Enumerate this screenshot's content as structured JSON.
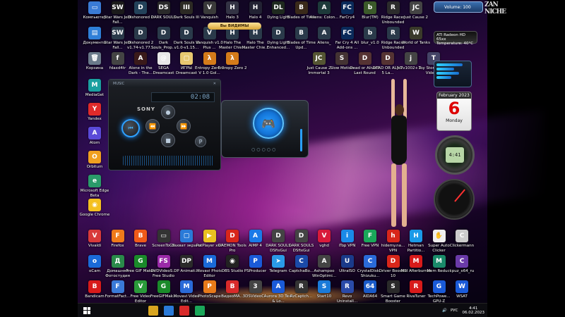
{
  "desktop": {
    "row1": [
      {
        "label": "Компьютер",
        "color": "#3a7bd5",
        "glyph": "▭"
      },
      {
        "label": "Star Wars Jedi Fall...",
        "color": "#1b1b1b",
        "glyph": "SW"
      },
      {
        "label": "Dishonored 2",
        "color": "#23425a",
        "glyph": "D"
      },
      {
        "label": "DARK SOULS",
        "color": "#2a2a2a",
        "glyph": "DS"
      },
      {
        "label": "Dark Souls III",
        "color": "#2c2a24",
        "glyph": "III"
      },
      {
        "label": "Vanquish",
        "color": "#3a3a3a",
        "glyph": "V"
      },
      {
        "label": "Halo 3",
        "color": "#334",
        "glyph": "H"
      },
      {
        "label": "Halo 4",
        "color": "#223",
        "glyph": "H"
      },
      {
        "label": "Dying Light",
        "color": "#1f2a1f",
        "glyph": "DL"
      },
      {
        "label": "Blades of Time",
        "color": "#3a2a1a",
        "glyph": "B"
      },
      {
        "label": "Aliens: Colon...",
        "color": "#1d3a3a",
        "glyph": "A"
      },
      {
        "label": "FarCry4",
        "color": "#0a2a5a",
        "glyph": "FC"
      },
      {
        "label": "Blur(TM)",
        "color": "#3b5a2a",
        "glyph": "b"
      },
      {
        "label": "Ridge Racer Unbounded",
        "color": "#2c2c2c",
        "glyph": "R"
      },
      {
        "label": "Just Cause 2",
        "color": "#444",
        "glyph": "JC"
      }
    ],
    "row2": [
      {
        "label": "Документы",
        "color": "#2f7fd8",
        "glyph": "▤"
      },
      {
        "label": "Star Wars Jedi Fall...",
        "color": "#2a3a4a",
        "glyph": "SW"
      },
      {
        "label": "Dishonored 2 v1.74-v1.77...",
        "color": "#2a3a4a",
        "glyph": "D"
      },
      {
        "label": "Dark Souls_Prop...",
        "color": "#2a3a4a",
        "glyph": "D"
      },
      {
        "label": "Dark Souls III v1.0-v1.15...",
        "color": "#2a3a4a",
        "glyph": "D"
      },
      {
        "label": "Vanquish v1.0 Plus ...",
        "color": "#2a3a4a",
        "glyph": "V"
      },
      {
        "label": "Halo The Master Chie...",
        "color": "#2a3a4a",
        "glyph": "H"
      },
      {
        "label": "Halo The Master Chie...",
        "color": "#2a3a4a",
        "glyph": "H"
      },
      {
        "label": "Dying Light Enhanced...",
        "color": "#2a3a4a",
        "glyph": "D"
      },
      {
        "label": "Blades of Time Upd...",
        "color": "#2a3a4a",
        "glyph": "B"
      },
      {
        "label": "Aliens_",
        "color": "#2a3a4a",
        "glyph": "A"
      },
      {
        "label": "Far Cry 4 All Add-ons ...",
        "color": "#0a2a5a",
        "glyph": "FC"
      },
      {
        "label": "blur_v1.0",
        "color": "#2a3a4a",
        "glyph": "b"
      },
      {
        "label": "Ridge Racer Unbounded",
        "color": "#2a3a4a",
        "glyph": "R"
      },
      {
        "label": "World of Tanks",
        "color": "#3a3a2a",
        "glyph": "W"
      }
    ],
    "row3": [
      {
        "label": "Корзина",
        "color": "#6a7a8a",
        "glyph": "🗑"
      },
      {
        "label": "fdaxd4tr",
        "color": "#444",
        "glyph": "f"
      },
      {
        "label": "Alone in the Dark - The...",
        "color": "#3a1a1a",
        "glyph": "A"
      },
      {
        "label": "SEGA Dreamcast",
        "color": "#e8e8e8",
        "glyph": "@"
      },
      {
        "label": "ИГРЫ Dreamcast",
        "color": "#e8c870",
        "glyph": "▢"
      },
      {
        "label": "Entropy Zero 2 V 1.0 Gol...",
        "color": "#d47b1a",
        "glyph": "λ"
      },
      {
        "label": "Entropy Zero 2",
        "color": "#d47b1a",
        "glyph": "λ"
      },
      {
        "label": "Just Cause 2 Immortal 3",
        "color": "#553",
        "glyph": "JC"
      },
      {
        "label": "Slow Motion",
        "color": "#433",
        "glyph": "S"
      },
      {
        "label": "Dead or Alive 5 Last Round",
        "color": "#533",
        "glyph": "D"
      },
      {
        "label": "DEAD OR ALIVE 5 La...",
        "color": "#533",
        "glyph": "D"
      },
      {
        "label": "jc2v1002+1...",
        "color": "#444",
        "glyph": "j"
      },
      {
        "label": "Toy Story 3 The Video ...",
        "color": "#446",
        "glyph": "T"
      }
    ],
    "left_col": [
      {
        "label": "MediaGet",
        "color": "#1aa0a0",
        "glyph": "M"
      },
      {
        "label": "Yandex",
        "color": "#e02a2a",
        "glyph": "Y"
      },
      {
        "label": "Atom",
        "color": "#5a4ad8",
        "glyph": "A"
      },
      {
        "label": "Orbitum",
        "color": "#f0a020",
        "glyph": "O"
      },
      {
        "label": "Microsoft Edge Beta",
        "color": "#2a9a6a",
        "glyph": "e"
      },
      {
        "label": "Google Chrome",
        "color": "#f4c020",
        "glyph": "◉"
      }
    ],
    "row4": [
      {
        "label": "Vivaldi",
        "color": "#d83a3a",
        "glyph": "V"
      },
      {
        "label": "Firefox",
        "color": "#f07a1a",
        "glyph": "F"
      },
      {
        "label": "Brave",
        "color": "#f05a1a",
        "glyph": "B"
      },
      {
        "label": "ScreenToGif",
        "color": "#333",
        "glyph": "▭"
      },
      {
        "label": "Захват экрана",
        "color": "#2a7ad8",
        "glyph": "▢"
      },
      {
        "label": "PotPlayer x64",
        "color": "#e8c020",
        "glyph": "▶"
      },
      {
        "label": "DAEMON Tools Pro",
        "color": "#d8261a",
        "glyph": "D"
      },
      {
        "label": "AIMP 4",
        "color": "#1a7ae8",
        "glyph": "A"
      },
      {
        "label": "DARK SOULS DSfixGui",
        "color": "#444",
        "glyph": "D"
      },
      {
        "label": "DARK SOULS DSfixGui",
        "color": "#444",
        "glyph": "D"
      },
      {
        "label": "vghd",
        "color": "#d81a3a",
        "glyph": "V"
      },
      {
        "label": "iTop VPN",
        "color": "#1a8ae8",
        "glyph": "i"
      },
      {
        "label": "Free VPN",
        "color": "#1aa85a",
        "glyph": "F"
      },
      {
        "label": "hidemy.na... VPN",
        "color": "#d8261a",
        "glyph": "h"
      },
      {
        "label": "Hetman Partitio...",
        "color": "#1a9ae8",
        "glyph": "H"
      },
      {
        "label": "Super Auto Clicker",
        "color": "#eee",
        "glyph": "✋"
      },
      {
        "label": "Clickermann",
        "color": "#ccc",
        "glyph": "C"
      }
    ],
    "row5": [
      {
        "label": "oCam",
        "color": "#1a6ad8",
        "glyph": "o"
      },
      {
        "label": "Домашняя Фотостудия",
        "color": "#2a8a4a",
        "glyph": "Д"
      },
      {
        "label": "Free GIF Maker",
        "color": "#1a8a2a",
        "glyph": "G"
      },
      {
        "label": "DVDVideoS... Free Studio",
        "color": "#9a2aa8",
        "glyph": "FS"
      },
      {
        "label": "DP Animati...",
        "color": "#2a2a2a",
        "glyph": "DP"
      },
      {
        "label": "Movavi Photo Editor",
        "color": "#1a6ad8",
        "glyph": "M"
      },
      {
        "label": "OBS Studio",
        "color": "#222",
        "glyph": "◉"
      },
      {
        "label": "PSProducer",
        "color": "#1a5ad8",
        "glyph": "P"
      },
      {
        "label": "Telegram",
        "color": "#2a9ae8",
        "glyph": "➤"
      },
      {
        "label": "CaptchaBo...",
        "color": "#1a4aa8",
        "glyph": "C"
      },
      {
        "label": "Ashampoo WinOptimi...",
        "color": "#444",
        "glyph": "A"
      },
      {
        "label": "UltraISO",
        "color": "#1a3a8a",
        "glyph": "U"
      },
      {
        "label": "CrystalDisk... Shizuku...",
        "color": "#2a6ad8",
        "glyph": "C"
      },
      {
        "label": "Driver Booster 10",
        "color": "#d8261a",
        "glyph": "D"
      },
      {
        "label": "MSI Afterburner",
        "color": "#d81a1a",
        "glyph": "M"
      },
      {
        "label": "Mem Reduct",
        "color": "#1a8a6a",
        "glyph": "M"
      },
      {
        "label": "cpuz_x64_ru",
        "color": "#6a3aa8",
        "glyph": "C"
      }
    ],
    "row6": [
      {
        "label": "Bandicam",
        "color": "#d81a1a",
        "glyph": "B"
      },
      {
        "label": "FormatFact...",
        "color": "#3a7ad8",
        "glyph": "F"
      },
      {
        "label": "Free Video Editor",
        "color": "#2a9a3a",
        "glyph": "V"
      },
      {
        "label": "FreeGIFMak...",
        "color": "#1a8a2a",
        "glyph": "G"
      },
      {
        "label": "Movavi Video Edit...",
        "color": "#2a6ad8",
        "glyph": "M"
      },
      {
        "label": "PhotoScape",
        "color": "#e87a1a",
        "glyph": "P"
      },
      {
        "label": "ВидеоМА...",
        "color": "#d82a2a",
        "glyph": "В"
      },
      {
        "label": "3DSVideoC...",
        "color": "#444",
        "glyph": "3"
      },
      {
        "label": "Aurora 3D Text & Lo...",
        "color": "#1a5ad8",
        "glyph": "A"
      },
      {
        "label": "RzCaptch...",
        "color": "#333",
        "glyph": "R"
      },
      {
        "label": "Start10",
        "color": "#1a7ad8",
        "glyph": "S"
      },
      {
        "label": "Revo Uninstall...",
        "color": "#2a4aa8",
        "glyph": "R"
      },
      {
        "label": "AIDA64",
        "color": "#1a5ac8",
        "glyph": "64"
      },
      {
        "label": "Smart Game Booster",
        "color": "#2a2a2a",
        "glyph": "S"
      },
      {
        "label": "RivaTuner",
        "color": "#d81a1a",
        "glyph": "R"
      },
      {
        "label": "TechPowe... GPU-Z",
        "color": "#1a5ad8",
        "glyph": "G"
      },
      {
        "label": "WSAT",
        "color": "#1a5ad8",
        "glyph": "W"
      }
    ]
  },
  "badge": "Вы ВИДИМЫ",
  "gadgets": {
    "volume_label": "Volume: 100",
    "side_text": "ZAN NICHE",
    "ati_line1": "ATI Radeon HD 65xx",
    "ati_line2": "Temperature: 40°C",
    "calendar_month": "February 2023",
    "calendar_day": "6",
    "calendar_weekday": "Monday",
    "clock_text": "4:41",
    "meter_levels": [
      0.8,
      0.55,
      0.7,
      0.45
    ]
  },
  "player": {
    "title": "MUSIC",
    "screen_text": "02:08",
    "brand": "SONY",
    "buttons": [
      "⏮",
      "⏪",
      "■",
      "⏩",
      "●"
    ]
  },
  "gamepad": {
    "icon": "🎮",
    "dots": "○○○○○"
  },
  "taskbar": {
    "lang": "РУС",
    "time": "4:41",
    "date": "06.02.2023",
    "apps": [
      "#d8a520",
      "#2a7ad8",
      "#d82a2a",
      "#1aa85a"
    ]
  }
}
